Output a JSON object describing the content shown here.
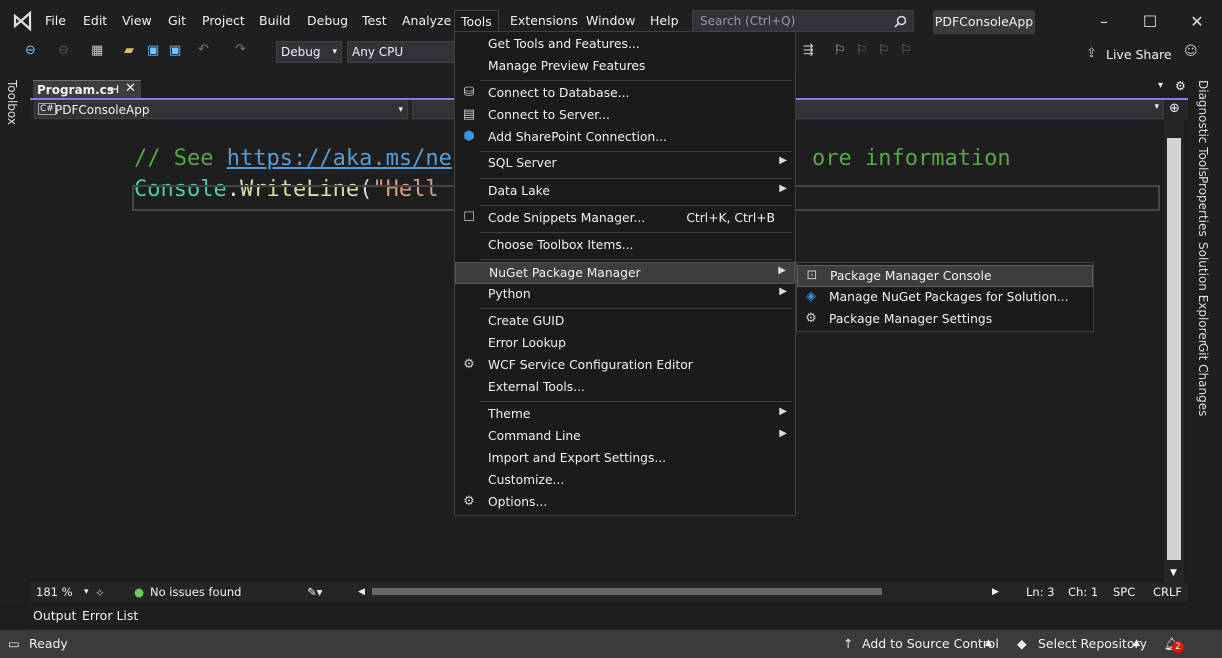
{
  "menubar": {
    "items": [
      "File",
      "Edit",
      "View",
      "Git",
      "Project",
      "Build",
      "Debug",
      "Test",
      "Analyze",
      "Tools",
      "Extensions",
      "Window",
      "Help"
    ],
    "active": "Tools"
  },
  "search": {
    "placeholder": "Search (Ctrl+Q)"
  },
  "project_badge": "PDFConsoleApp",
  "toolbar": {
    "config": "Debug",
    "platform": "Any CPU",
    "live_share": "Live Share"
  },
  "left_strip": {
    "toolbox": "Toolbox"
  },
  "editor": {
    "tab": "Program.cs",
    "nav_project": "PDFConsoleApp",
    "line1_comment": "// See ",
    "line1_link": "https://aka.ms/ne",
    "line1_tail": "ore information",
    "line2_console": "Console",
    "line2_dot": ".",
    "line2_method": "WriteLine",
    "line2_paren": "(",
    "line2_str": "\"Hell",
    "zoom": "181 %",
    "issues": "No issues found",
    "ln": "Ln: 3",
    "ch": "Ch: 1",
    "spc": "SPC",
    "crlf": "CRLF"
  },
  "right_strip": [
    "Diagnostic Tools",
    "Properties",
    "Solution Explorer",
    "Git Changes"
  ],
  "panel_tabs": [
    "Output",
    "Error List"
  ],
  "statusbar": {
    "ready": "Ready",
    "add_source": "Add to Source Control",
    "select_repo": "Select Repository",
    "notifications": "2"
  },
  "tools_menu": {
    "items": [
      {
        "label": "Get Tools and Features...",
        "shortcut": "",
        "icon": "",
        "submenu": false
      },
      {
        "label": "Manage Preview Features",
        "shortcut": "",
        "icon": "",
        "submenu": false
      },
      {
        "label": "Connect to Database...",
        "shortcut": "",
        "icon": "database-connect-icon",
        "submenu": false
      },
      {
        "label": "Connect to Server...",
        "shortcut": "",
        "icon": "server-connect-icon",
        "submenu": false
      },
      {
        "label": "Add SharePoint Connection...",
        "shortcut": "",
        "icon": "sharepoint-icon",
        "submenu": false
      },
      {
        "label": "SQL Server",
        "shortcut": "",
        "icon": "",
        "submenu": true
      },
      {
        "label": "Data Lake",
        "shortcut": "",
        "icon": "",
        "submenu": true
      },
      {
        "label": "Code Snippets Manager...",
        "shortcut": "Ctrl+K, Ctrl+B",
        "icon": "snippet-icon",
        "submenu": false
      },
      {
        "label": "Choose Toolbox Items...",
        "shortcut": "",
        "icon": "",
        "submenu": false
      },
      {
        "label": "NuGet Package Manager",
        "shortcut": "",
        "icon": "",
        "submenu": true
      },
      {
        "label": "Python",
        "shortcut": "",
        "icon": "",
        "submenu": true
      },
      {
        "label": "Create GUID",
        "shortcut": "",
        "icon": "",
        "submenu": false
      },
      {
        "label": "Error Lookup",
        "shortcut": "",
        "icon": "",
        "submenu": false
      },
      {
        "label": "WCF Service Configuration Editor",
        "shortcut": "",
        "icon": "wcf-gear-icon",
        "submenu": false
      },
      {
        "label": "External Tools...",
        "shortcut": "",
        "icon": "",
        "submenu": false
      },
      {
        "label": "Theme",
        "shortcut": "",
        "icon": "",
        "submenu": true
      },
      {
        "label": "Command Line",
        "shortcut": "",
        "icon": "",
        "submenu": true
      },
      {
        "label": "Import and Export Settings...",
        "shortcut": "",
        "icon": "",
        "submenu": false
      },
      {
        "label": "Customize...",
        "shortcut": "",
        "icon": "",
        "submenu": false
      },
      {
        "label": "Options...",
        "shortcut": "",
        "icon": "gear-icon",
        "submenu": false
      }
    ]
  },
  "nuget_submenu": {
    "items": [
      {
        "label": "Package Manager Console",
        "icon": "console-icon"
      },
      {
        "label": "Manage NuGet Packages for Solution...",
        "icon": "nuget-icon"
      },
      {
        "label": "Package Manager Settings",
        "icon": "gear-icon"
      }
    ]
  },
  "colors": {
    "accent": "#9974e4",
    "comment": "#57a64a",
    "link": "#569cd6",
    "type": "#4ec9b0",
    "method": "#dcdcaa",
    "string": "#d69d85"
  }
}
